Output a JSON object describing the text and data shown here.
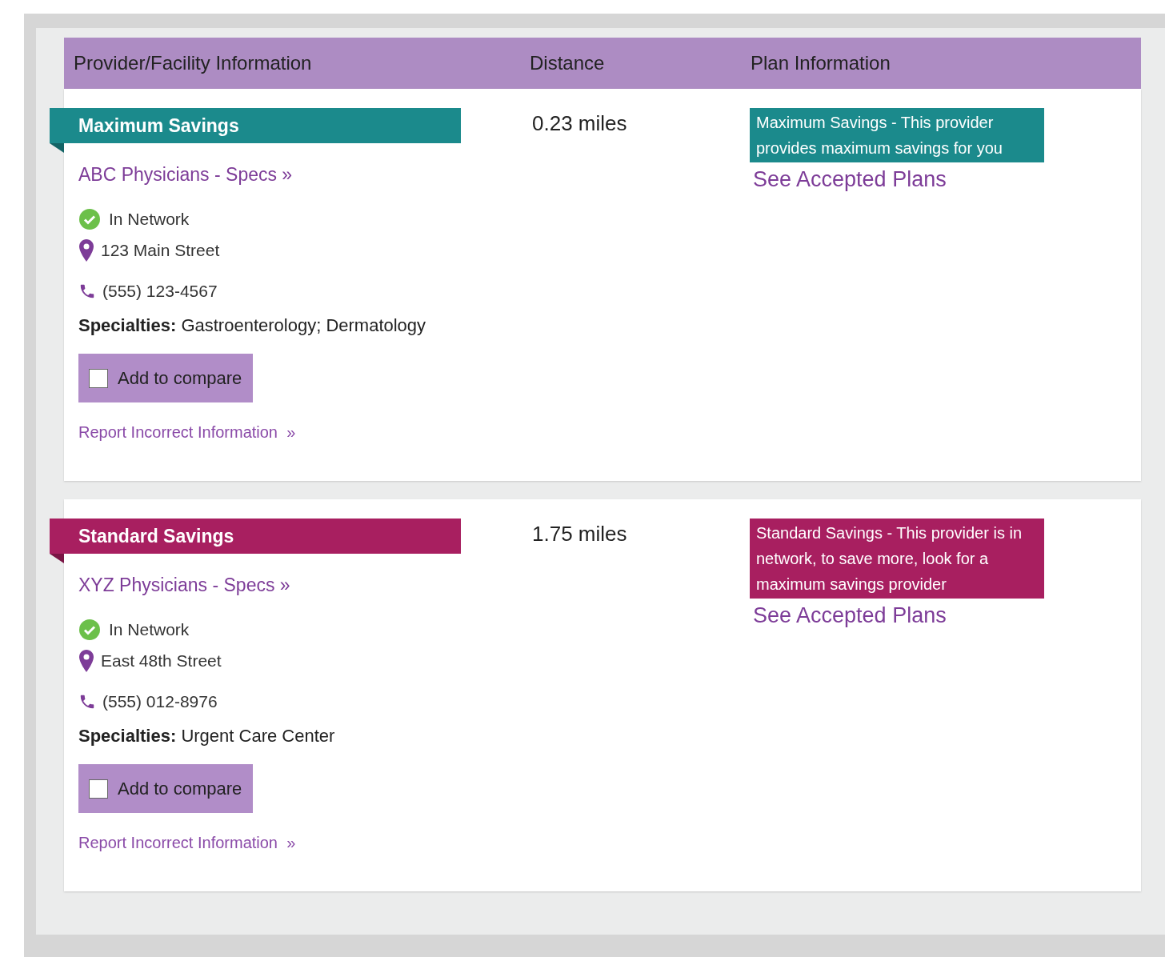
{
  "columns": [
    "Provider/Facility Information",
    "Distance",
    "Plan Information"
  ],
  "providers": [
    {
      "kind": "maximum",
      "tier_label": "Maximum Savings",
      "name": "ABC Physicians - Specs »",
      "network": "In Network",
      "address": "123 Main Street",
      "phone": "(555) 123-4567",
      "specialties": "**Specialties:** Gastroenterology; Dermatology",
      "compare": {
        "label": "Add to compare",
        "checked": false
      },
      "report_link": "Report Incorrect Information",
      "report_arrow": "»",
      "distance": "0.23 miles",
      "plan_note": "Maximum Savings - This provider provides maximum savings for you",
      "plan_link": "See Accepted Plans"
    },
    {
      "kind": "standard",
      "tier_label": "Standard Savings",
      "name": "XYZ Physicians - Specs »",
      "network": "In Network",
      "address": "East 48th Street",
      "phone": "(555) 012-8976",
      "specialties": "**Specialties:** Urgent Care Center",
      "compare": {
        "label": "Add to compare",
        "checked": false
      },
      "report_link": "Report Incorrect Information",
      "report_arrow": "»",
      "distance": "1.75 miles",
      "plan_note": "Standard Savings - This provider is in network, to save more, look for a maximum savings provider",
      "plan_link": "See Accepted Plans"
    }
  ]
}
